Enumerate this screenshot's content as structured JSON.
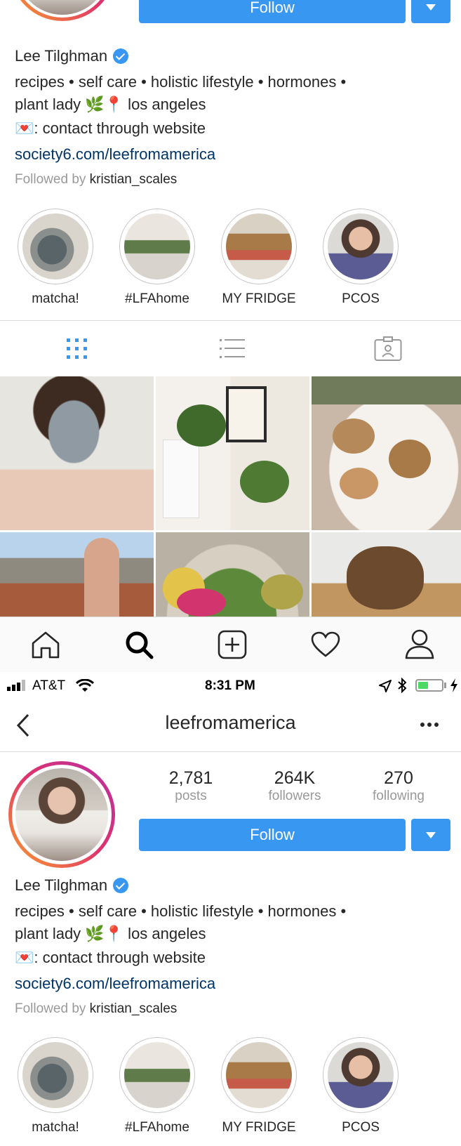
{
  "top": {
    "follow_label": "Follow",
    "name": "Lee Tilghman",
    "bio_line1": "recipes • self care • holistic lifestyle • hormones •",
    "bio_line2": "plant lady 🌿📍 los angeles",
    "bio_line3": "💌: contact through website",
    "website": "society6.com/leefromamerica",
    "followed_by_prefix": "Followed by",
    "followed_by_user": "kristian_scales",
    "highlights": [
      {
        "label": "matcha!"
      },
      {
        "label": "#LFAhome"
      },
      {
        "label": "MY FRIDGE"
      },
      {
        "label": "PCOS"
      }
    ]
  },
  "tabs": [
    "grid-view",
    "list-view",
    "tagged-view"
  ],
  "bottom_nav": [
    "home-icon",
    "search-icon",
    "add-post-icon",
    "activity-heart-icon",
    "profile-icon"
  ],
  "status_bar": {
    "carrier": "AT&T",
    "time": "8:31 PM",
    "battery_color": "#4cd964"
  },
  "header": {
    "username": "leefromamerica"
  },
  "profile": {
    "stats": [
      {
        "value": "2,781",
        "label": "posts"
      },
      {
        "value": "264K",
        "label": "followers"
      },
      {
        "value": "270",
        "label": "following"
      }
    ],
    "follow_label": "Follow",
    "name": "Lee Tilghman",
    "bio_line1": "recipes • self care • holistic lifestyle • hormones •",
    "bio_line2": "plant lady 🌿📍 los angeles",
    "bio_line3": "💌: contact through website",
    "website": "society6.com/leefromamerica",
    "followed_by_prefix": "Followed by",
    "followed_by_user": "kristian_scales",
    "highlights": [
      {
        "label": "matcha!"
      },
      {
        "label": "#LFAhome"
      },
      {
        "label": "MY FRIDGE"
      },
      {
        "label": "PCOS"
      }
    ]
  },
  "colors": {
    "accent": "#3897f0",
    "link": "#003569",
    "muted": "#999999"
  }
}
